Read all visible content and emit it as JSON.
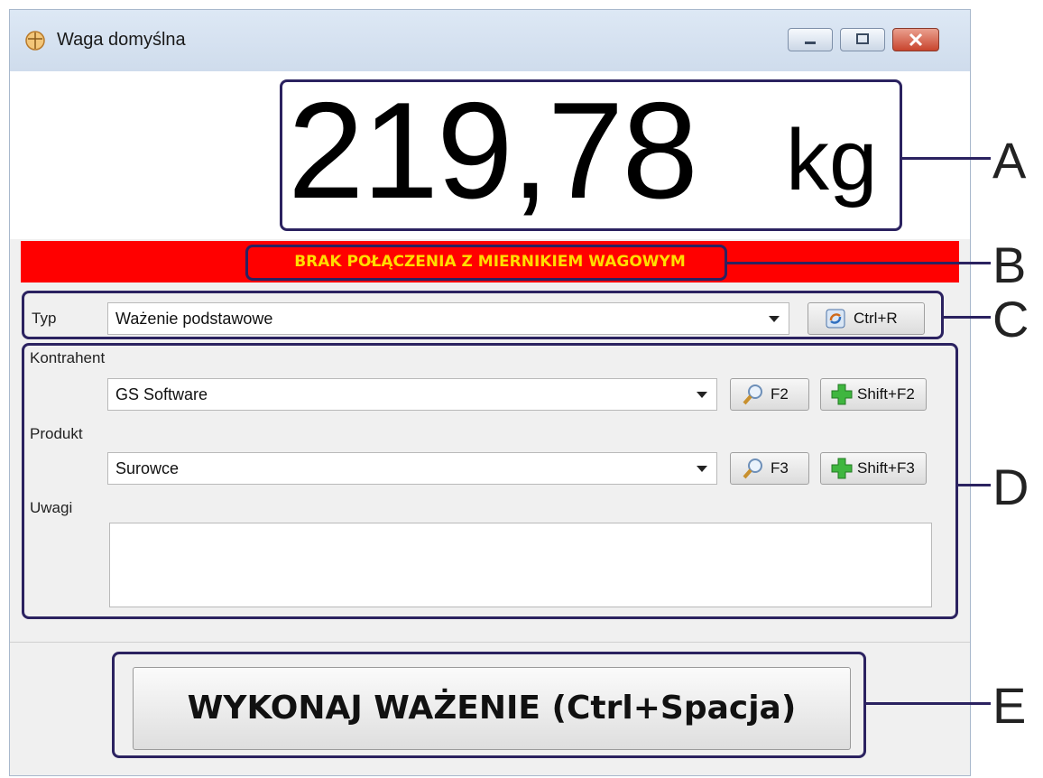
{
  "window": {
    "title": "Waga domyślna"
  },
  "display": {
    "weight_value": "219,78",
    "weight_unit": "kg"
  },
  "status": {
    "message": "BRAK POŁĄCZENIA Z MIERNIKIEM WAGOWYM",
    "bg_color": "#ff0000",
    "text_color": "#ffdd00"
  },
  "type_section": {
    "label": "Typ",
    "value": "Ważenie podstawowe",
    "refresh_button": "Ctrl+R"
  },
  "details": {
    "contractor_label": "Kontrahent",
    "contractor_value": "GS Software",
    "contractor_search": "F2",
    "contractor_add": "Shift+F2",
    "product_label": "Produkt",
    "product_value": "Surowce",
    "product_search": "F3",
    "product_add": "Shift+F3",
    "notes_label": "Uwagi",
    "notes_value": ""
  },
  "action": {
    "weigh_button": "WYKONAJ WAŻENIE (Ctrl+Spacja)"
  },
  "callouts": [
    "A",
    "B",
    "C",
    "D",
    "E"
  ],
  "colors": {
    "callout": "#2b2260"
  }
}
